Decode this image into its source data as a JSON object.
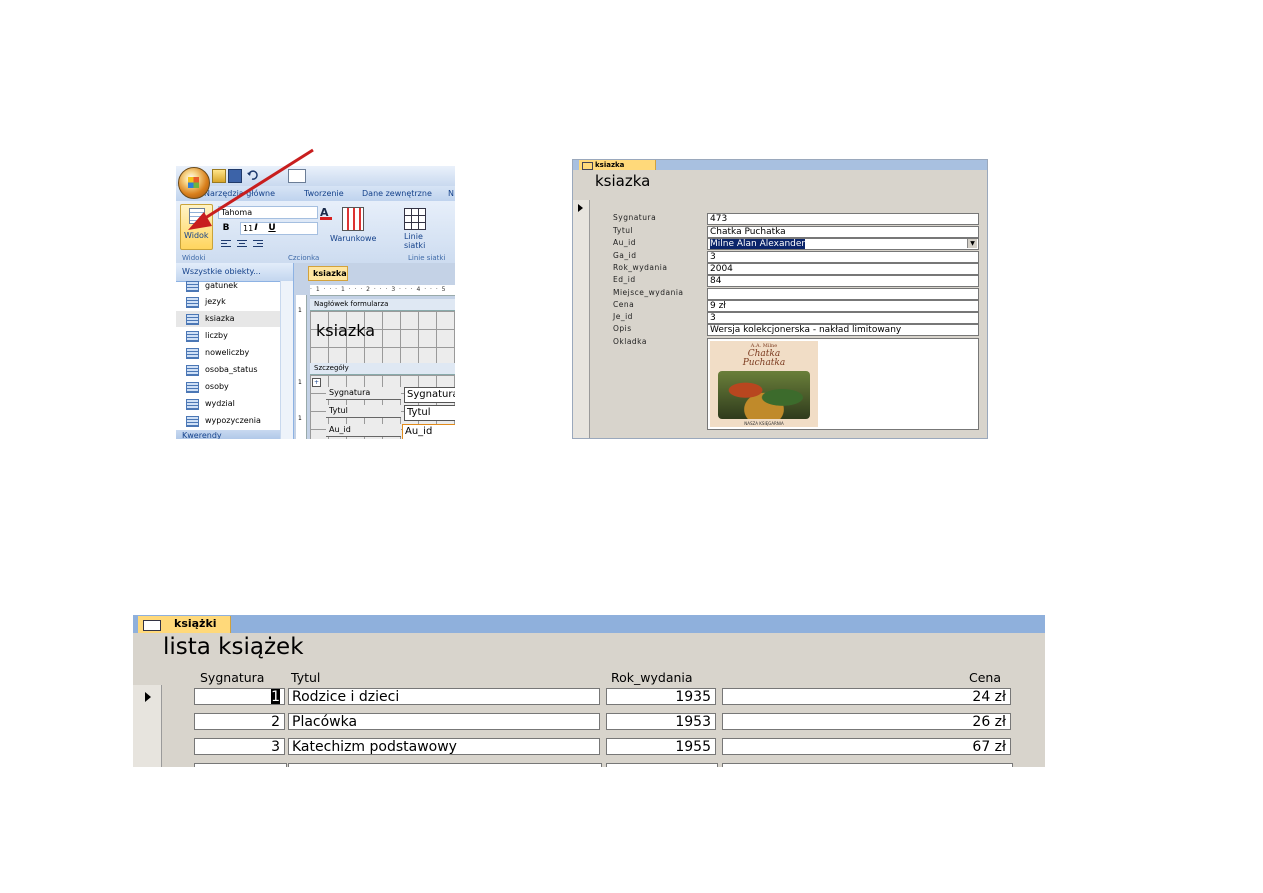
{
  "panel_design": {
    "quick_access_tooltip_hint": "",
    "ribbon_tabs": [
      "Narzędzia główne",
      "Tworzenie",
      "Dane zewnętrzne",
      "N"
    ],
    "view_button_label": "Widok",
    "font_name": "Tahoma",
    "font_size": "11",
    "format_buttons": [
      "B",
      "I",
      "U"
    ],
    "conditional_label": "Warunkowe",
    "gridlines_label_line1": "Linie",
    "gridlines_label_line2": "siatki",
    "group_labels": {
      "views": "Widoki",
      "font": "Czcionka",
      "gridlines": "Linie siatki"
    },
    "nav_header": "Wszystkie obiekty...",
    "nav_items": [
      {
        "label": "gatunek"
      },
      {
        "label": "jezyk"
      },
      {
        "label": "ksiazka"
      },
      {
        "label": "liczby"
      },
      {
        "label": "noweliczby"
      },
      {
        "label": "osoba_status"
      },
      {
        "label": "osoby"
      },
      {
        "label": "wydzial"
      },
      {
        "label": "wypozyczenia"
      }
    ],
    "nav_footer": "Kwerendy",
    "doc_tab": "ksiazka",
    "ruler_text": "· 1 · · · 1 · · · 2 · · · 3 · · · 4 · · · 5",
    "section_header": "Nagłówek formularza",
    "header_title": "ksiazka",
    "section_details": "Szczegóły",
    "design_labels": [
      "Sygnatura",
      "Tytul",
      "Au_id"
    ],
    "design_boxes": [
      "Sygnatura",
      "Tytul",
      "Au_id"
    ],
    "ruler_v_marks": [
      "1",
      "1",
      "1"
    ]
  },
  "panel_form": {
    "tab": "ksiazka",
    "title": "ksiazka",
    "fields": [
      {
        "label": "Sygnatura",
        "value": "473"
      },
      {
        "label": "Tytul",
        "value": "Chatka Puchatka"
      },
      {
        "label": "Au_id",
        "value": "Milne Alan Alexander"
      },
      {
        "label": "Ga_id",
        "value": "3"
      },
      {
        "label": "Rok_wydania",
        "value": "2004"
      },
      {
        "label": "Ed_id",
        "value": "84"
      },
      {
        "label": "Miejsce_wydania",
        "value": ""
      },
      {
        "label": "Cena",
        "value": "9 zł"
      },
      {
        "label": "Je_id",
        "value": "3"
      },
      {
        "label": "Opis",
        "value": "Wersja kolekcjonerska - nakład limitowany"
      }
    ],
    "image_label": "Okladka",
    "cover_author": "A.A. Milne",
    "cover_title_1": "Chatka",
    "cover_title_2": "Puchatka",
    "cover_publisher": "NASZA KSIĘGARNIA"
  },
  "panel_list": {
    "tab": "książki",
    "title": "lista książek",
    "columns": [
      "Sygnatura",
      "Tytul",
      "Rok_wydania",
      "Cena"
    ],
    "rows": [
      {
        "sygnatura": "1",
        "tytul": "Rodzice i dzieci",
        "rok": "1935",
        "cena": "24 zł"
      },
      {
        "sygnatura": "2",
        "tytul": "Placówka",
        "rok": "1953",
        "cena": "26 zł"
      },
      {
        "sygnatura": "3",
        "tytul": "Katechizm podstawowy",
        "rok": "1955",
        "cena": "67 zł"
      }
    ]
  },
  "colors": {
    "arrow": "#c81e1e",
    "access_blue": "#15428b",
    "tab_gold": "#ffd97a"
  }
}
